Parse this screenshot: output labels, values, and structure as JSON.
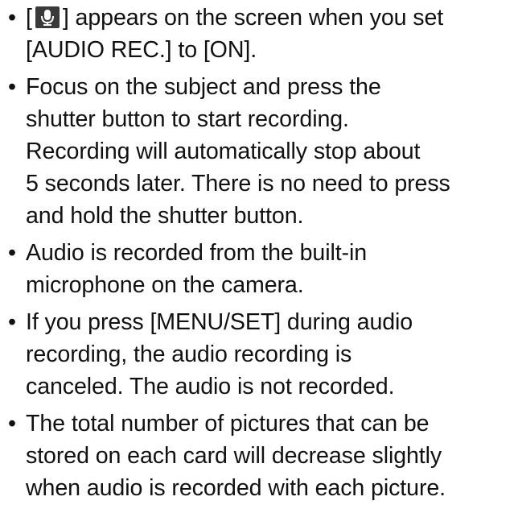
{
  "bullets": [
    {
      "lines": [
        {
          "before": "[",
          "after": "] appears on the screen when you set"
        },
        "[AUDIO REC.] to [ON]."
      ],
      "icon": "microphone-icon"
    },
    {
      "lines": [
        "Focus on the subject and press the",
        "shutter button to start recording.",
        "Recording will automatically stop about",
        "5 seconds later. There is no need to press",
        "and hold the shutter button."
      ]
    },
    {
      "lines": [
        "Audio is recorded from the built-in",
        "microphone on the camera."
      ]
    },
    {
      "lines": [
        "If you press [MENU/SET] during audio",
        "recording, the audio recording is",
        "canceled. The audio is not recorded."
      ]
    },
    {
      "lines": [
        "The total number of pictures that can be",
        "stored on each card will decrease slightly",
        "when audio is recorded with each picture."
      ]
    }
  ],
  "bullet_symbol": "•"
}
